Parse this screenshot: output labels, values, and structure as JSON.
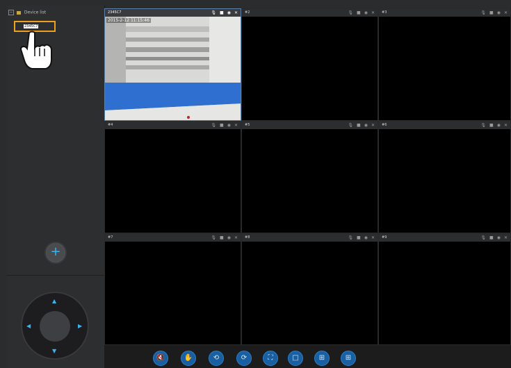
{
  "sidebar": {
    "tree_root_label": "Device list",
    "tree_toggle": "−",
    "camera_item_label": "2345C7",
    "add_button_glyph": "+",
    "ptz": {
      "up": "▲",
      "down": "▼",
      "left": "◀",
      "right": "▶"
    }
  },
  "tiles": [
    {
      "label": "2345C7",
      "active": true
    },
    {
      "label": "#2",
      "active": false
    },
    {
      "label": "#3",
      "active": false
    },
    {
      "label": "#4",
      "active": false
    },
    {
      "label": "#5",
      "active": false
    },
    {
      "label": "#6",
      "active": false
    },
    {
      "label": "#7",
      "active": false
    },
    {
      "label": "#8",
      "active": false
    },
    {
      "label": "#9",
      "active": false
    }
  ],
  "video_overlay": {
    "timestamp": "2015-2-12  11:15:46"
  },
  "tile_icons": {
    "mic": "🎙",
    "record": "■",
    "snapshot": "◉",
    "close": "✕"
  },
  "toolbar": {
    "buttons": [
      {
        "name": "mute",
        "glyph": "🔇"
      },
      {
        "name": "hand-drag",
        "glyph": "✋"
      },
      {
        "name": "rotate-left",
        "glyph": "⟲"
      },
      {
        "name": "rotate-right",
        "glyph": "⟳"
      },
      {
        "name": "fullscreen",
        "glyph": "⛶"
      },
      {
        "name": "layout-1",
        "glyph": "□"
      },
      {
        "name": "layout-4",
        "glyph": "⊞"
      },
      {
        "name": "layout-9",
        "glyph": "⊞"
      }
    ]
  },
  "colors": {
    "accent": "#39b6f0",
    "highlight": "#f0a020",
    "toolbar_button": "#1a5fa0"
  }
}
